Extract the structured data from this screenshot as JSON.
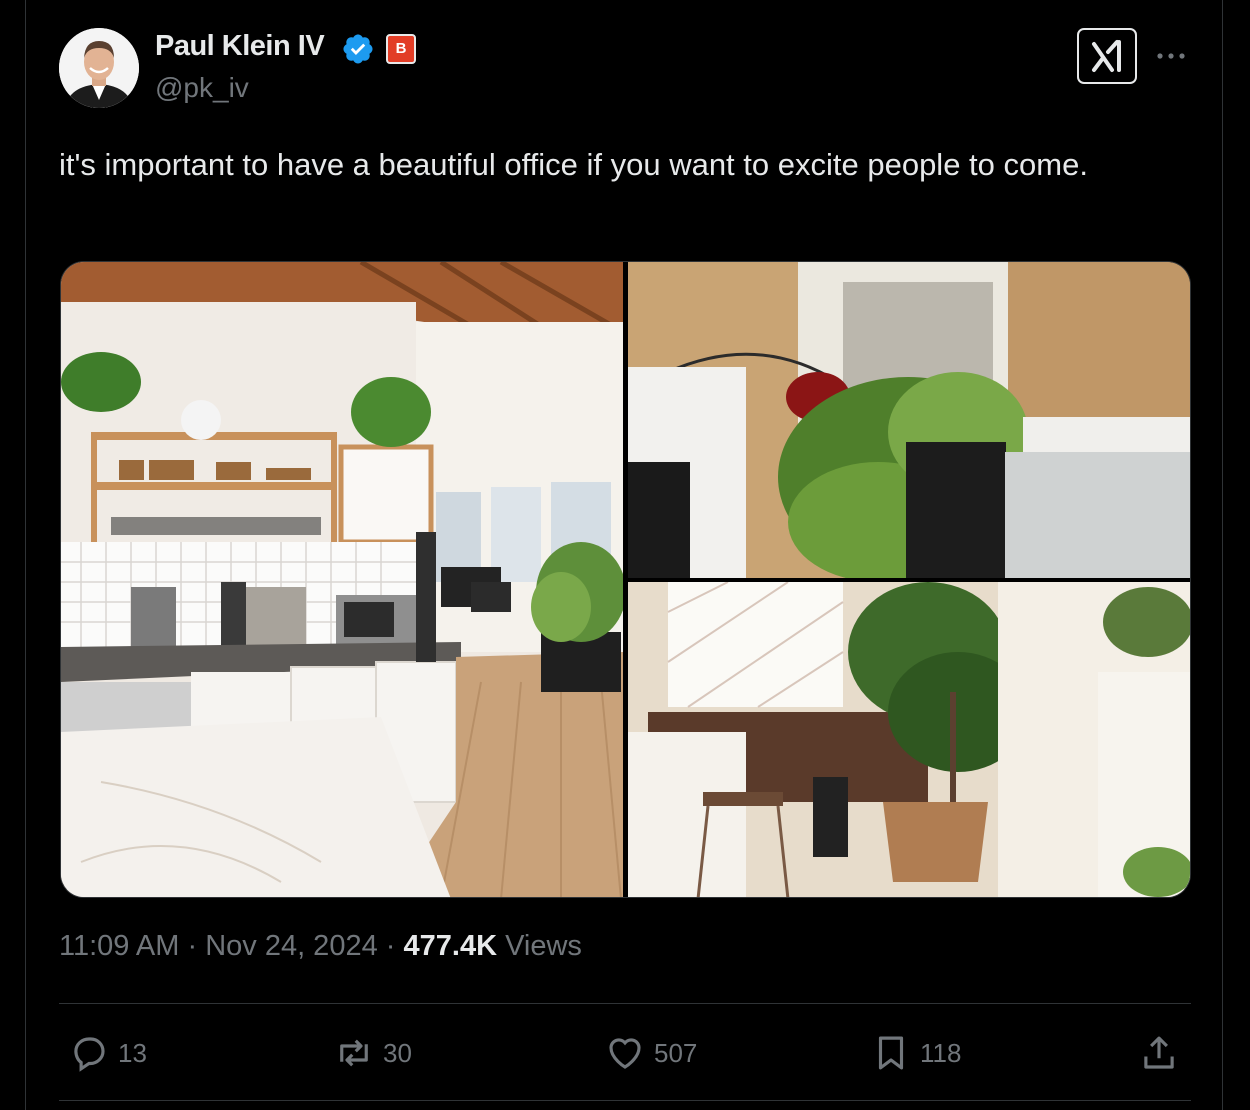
{
  "author": {
    "name": "Paul Klein IV",
    "handle": "@pk_iv",
    "org_badge_letter": "B",
    "verified": true,
    "verified_color": "#1d9bf0"
  },
  "header_actions": {
    "grok_icon": "grok-icon",
    "more_icon": "more-horizontal-icon"
  },
  "tweet": {
    "text": "it's important to have a beautiful office if you want to excite people to come."
  },
  "media": {
    "count": 3
  },
  "meta": {
    "time": "11:09 AM",
    "separator": "·",
    "date": "Nov 24, 2024",
    "views_count": "477.4K",
    "views_label": "Views"
  },
  "actions": {
    "reply": {
      "icon": "reply-icon",
      "count": "13"
    },
    "retweet": {
      "icon": "retweet-icon",
      "count": "30"
    },
    "like": {
      "icon": "heart-icon",
      "count": "507"
    },
    "bookmark": {
      "icon": "bookmark-icon",
      "count": "118"
    },
    "share": {
      "icon": "share-icon"
    }
  }
}
